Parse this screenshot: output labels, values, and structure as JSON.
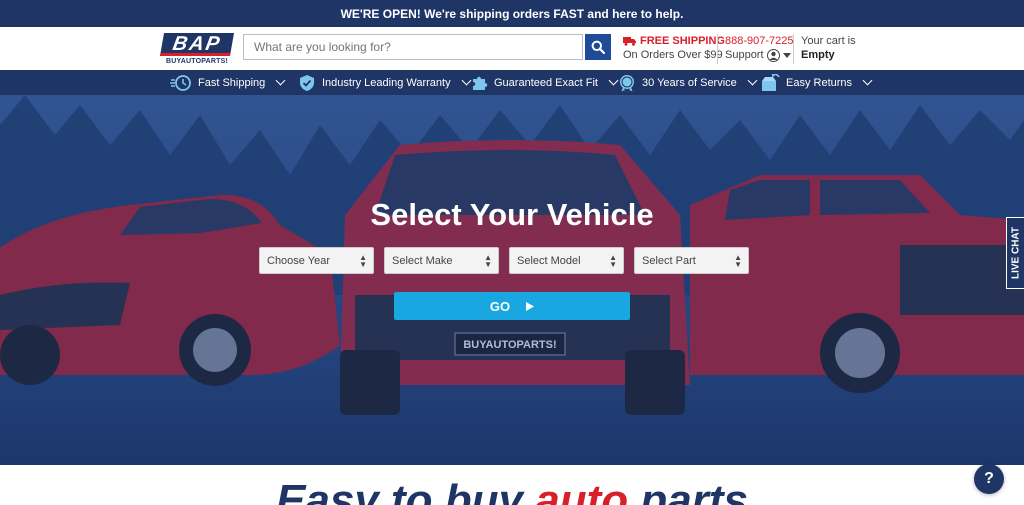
{
  "announcement": "WE'RE OPEN! We're shipping orders FAST and here to help.",
  "logo": {
    "letters": "BAP",
    "subtext": "BUYAUTOPARTS!"
  },
  "search": {
    "placeholder": "What are you looking for?",
    "value": ""
  },
  "shipping": {
    "title": "FREE SHIPPING",
    "subtitle": "On Orders Over $99"
  },
  "support": {
    "phone": "888-907-7225",
    "label": "Support"
  },
  "cart": {
    "label": "Your cart is",
    "status": "Empty"
  },
  "features": [
    {
      "label": "Fast Shipping",
      "icon": "clock-speed-icon"
    },
    {
      "label": "Industry Leading Warranty",
      "icon": "shield-check-icon"
    },
    {
      "label": "Guaranteed Exact Fit",
      "icon": "puzzle-icon"
    },
    {
      "label": "30 Years of Service",
      "icon": "badge-30-icon"
    },
    {
      "label": "Easy Returns",
      "icon": "return-box-icon"
    }
  ],
  "hero": {
    "title": "Select Your Vehicle",
    "selects": [
      "Choose Year",
      "Select Make",
      "Select Model",
      "Select Part"
    ],
    "go_label": "GO",
    "grille_badge": "BUYAUTOPARTS!"
  },
  "live_chat": "LIVE CHAT",
  "tagline": {
    "part1": "Easy to buy ",
    "accent": "auto",
    "part2": " parts"
  },
  "help": "?",
  "colors": {
    "navy": "#1f3566",
    "red": "#d8202a",
    "go_blue": "#18a7e0",
    "search_blue": "#1f4c99"
  }
}
